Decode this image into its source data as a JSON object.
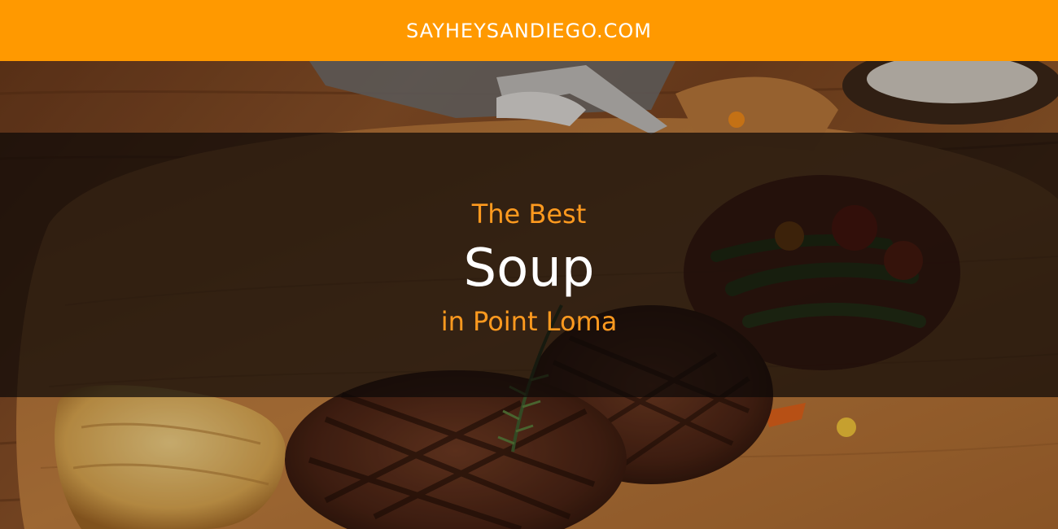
{
  "site": {
    "name": "SAYHEYSANDIEGO.COM",
    "accent_color": "#ff9900"
  },
  "headline": {
    "kicker": "The Best",
    "title": "Soup",
    "subtitle": "in Point Loma",
    "kicker_color": "#ff9a1f",
    "title_color": "#ffffff"
  },
  "background": {
    "subject": "grilled steak on a wooden board with baked potato, rosemary and vegetables"
  }
}
